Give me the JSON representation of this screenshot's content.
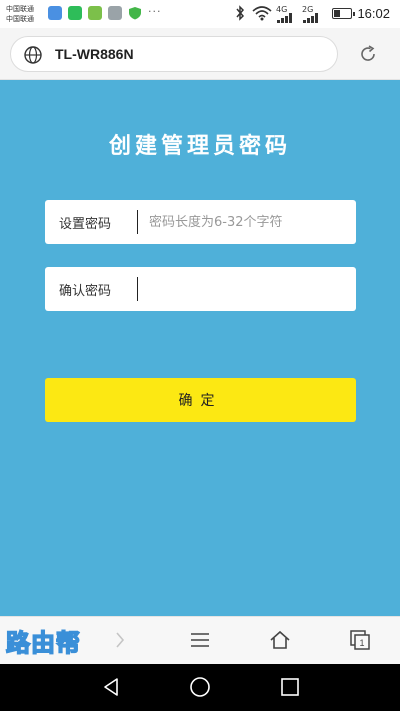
{
  "status_bar": {
    "carrier_1": "中国联通",
    "carrier_2": "中国联通",
    "more_dots": "···",
    "net_4g": "4G",
    "net_2g": "2G",
    "time": "16:02"
  },
  "address_bar": {
    "url": "TL-WR886N"
  },
  "page": {
    "title": "创建管理员密码",
    "set_password": {
      "label": "设置密码",
      "value": "",
      "placeholder": "密码长度为6-32个字符"
    },
    "confirm_password": {
      "label": "确认密码",
      "value": "",
      "placeholder": ""
    },
    "confirm_button": "确定"
  },
  "watermark": "路由帮",
  "colors": {
    "page_background": "#4fb0d9",
    "button_yellow": "#fce813",
    "field_background": "#ffffff"
  },
  "icons": {
    "address": "globe-icon",
    "refresh": "refresh-icon",
    "toolbar": [
      "forward-icon",
      "menu-icon",
      "home-icon",
      "tabs-icon"
    ],
    "navigation": [
      "back-icon",
      "home-circle-icon",
      "recent-apps-icon"
    ]
  }
}
